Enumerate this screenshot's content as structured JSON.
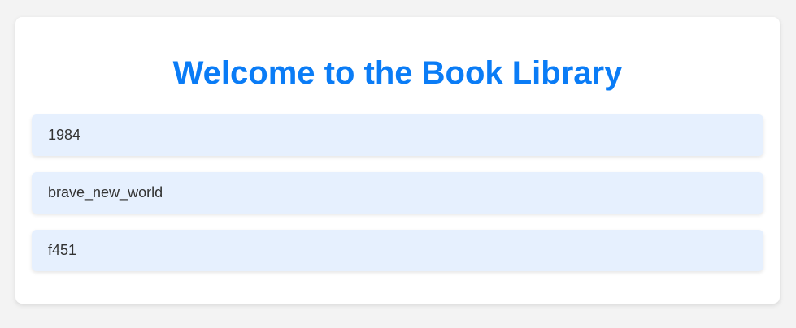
{
  "page": {
    "title": "Welcome to the Book Library"
  },
  "books": [
    {
      "label": "1984"
    },
    {
      "label": "brave_new_world"
    },
    {
      "label": "f451"
    }
  ],
  "colors": {
    "background": "#f3f3f3",
    "card": "#ffffff",
    "title": "#0a7cf6",
    "item_background": "#e6f0fe",
    "item_text": "#333333"
  }
}
